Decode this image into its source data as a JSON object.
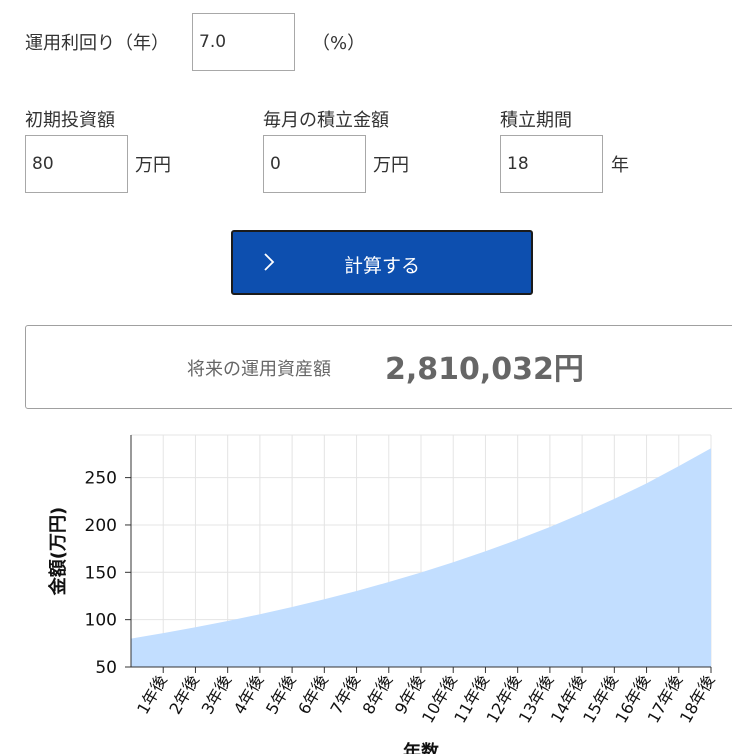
{
  "yield_field": {
    "label": "運用利回り（年）",
    "value": "7.0",
    "unit": "（%）"
  },
  "initial_investment": {
    "label": "初期投資額",
    "value": "80",
    "unit": "万円"
  },
  "monthly_contribution": {
    "label": "毎月の積立金額",
    "value": "0",
    "unit": "万円"
  },
  "period": {
    "label": "積立期間",
    "value": "18",
    "unit": "年"
  },
  "calculate_button": {
    "label": "計算する",
    "color": "#0d4faf"
  },
  "result": {
    "label": "将来の運用資産額",
    "value": "2,810,032円"
  },
  "chart_data": {
    "type": "area",
    "ylabel": "金額(万円)",
    "xlabel": "年数",
    "ylim": [
      50,
      295
    ],
    "yticks": [
      50,
      100,
      150,
      200,
      250
    ],
    "categories": [
      "1年後",
      "2年後",
      "3年後",
      "4年後",
      "5年後",
      "6年後",
      "7年後",
      "8年後",
      "9年後",
      "10年後",
      "11年後",
      "12年後",
      "13年後",
      "14年後",
      "15年後",
      "16年後",
      "17年後",
      "18年後"
    ],
    "x": [
      0,
      1,
      2,
      3,
      4,
      5,
      6,
      7,
      8,
      9,
      10,
      11,
      12,
      13,
      14,
      15,
      16,
      17,
      18
    ],
    "values": [
      80,
      85.8,
      92.0,
      98.6,
      105.7,
      113.3,
      121.5,
      130.3,
      139.7,
      149.8,
      160.6,
      172.2,
      184.6,
      197.9,
      212.2,
      227.5,
      243.9,
      262.1,
      281.0
    ],
    "fill_color": "#c2deff",
    "grid": true
  }
}
